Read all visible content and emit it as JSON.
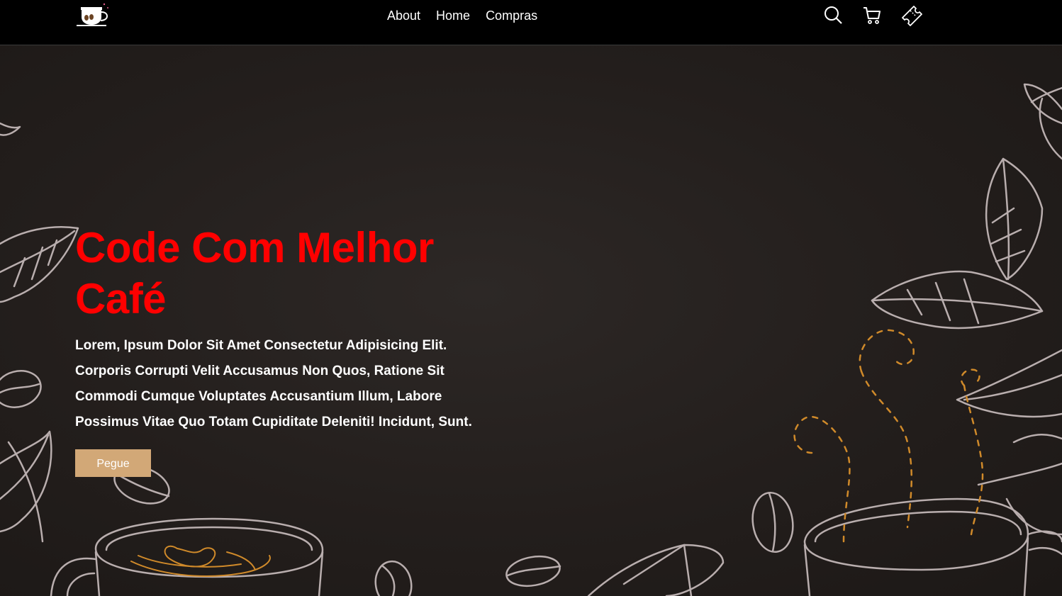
{
  "header": {
    "nav": [
      {
        "label": "About"
      },
      {
        "label": "Home"
      },
      {
        "label": "Compras"
      }
    ],
    "icons": [
      "search-icon",
      "cart-icon",
      "ticket-icon"
    ]
  },
  "hero": {
    "title": "Code Com Melhor Café",
    "description": "Lorem, Ipsum Dolor Sit Amet Consectetur Adipisicing Elit. Corporis Corrupti Velit Accusamus Non Quos, Ratione Sit Commodi Cumque Voluptates Accusantium Illum, Labore Possimus Vitae Quo Totam Cupiditate Deleniti! Incidunt, Sunt.",
    "button_label": "Pegue"
  },
  "colors": {
    "header_bg": "#000000",
    "hero_bg": "#231e1c",
    "title": "#ff0000",
    "button": "#d2a877",
    "line_art": "#b9aeae",
    "steam": "#d08a2a"
  }
}
